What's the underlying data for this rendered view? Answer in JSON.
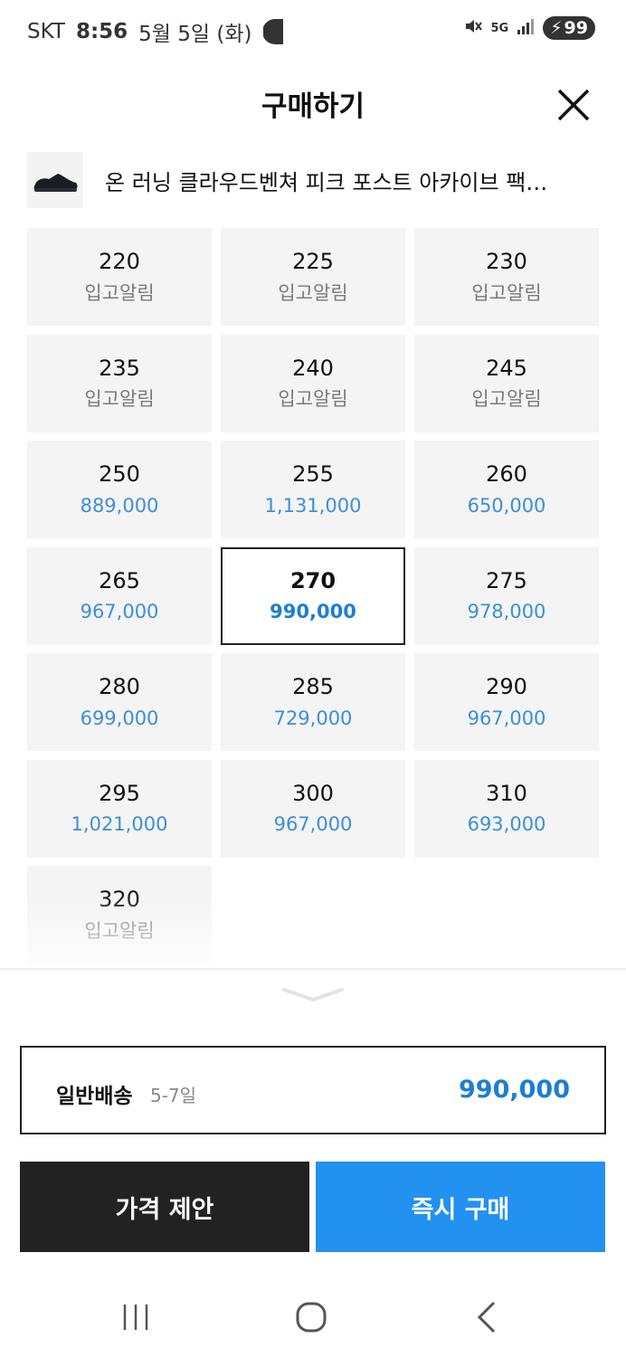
{
  "status_bar": {
    "carrier": "SKT",
    "time": "8:56",
    "date": "5월 5일 (화)",
    "network": "5G",
    "battery": "99"
  },
  "header": {
    "title": "구매하기",
    "close_icon": "close-icon"
  },
  "product": {
    "name": "온 러닝 클라우드벤쳐 피크 포스트 아카이브 팩…",
    "thumbnail_icon": "shoe-thumbnail"
  },
  "sizes": [
    {
      "size": "220",
      "price": "입고알림",
      "kind": "alert"
    },
    {
      "size": "225",
      "price": "입고알림",
      "kind": "alert"
    },
    {
      "size": "230",
      "price": "입고알림",
      "kind": "alert"
    },
    {
      "size": "235",
      "price": "입고알림",
      "kind": "alert"
    },
    {
      "size": "240",
      "price": "입고알림",
      "kind": "alert"
    },
    {
      "size": "245",
      "price": "입고알림",
      "kind": "alert"
    },
    {
      "size": "250",
      "price": "889,000",
      "kind": "price"
    },
    {
      "size": "255",
      "price": "1,131,000",
      "kind": "price"
    },
    {
      "size": "260",
      "price": "650,000",
      "kind": "price"
    },
    {
      "size": "265",
      "price": "967,000",
      "kind": "price"
    },
    {
      "size": "270",
      "price": "990,000",
      "kind": "price",
      "selected": true
    },
    {
      "size": "275",
      "price": "978,000",
      "kind": "price"
    },
    {
      "size": "280",
      "price": "699,000",
      "kind": "price"
    },
    {
      "size": "285",
      "price": "729,000",
      "kind": "price"
    },
    {
      "size": "290",
      "price": "967,000",
      "kind": "price"
    },
    {
      "size": "295",
      "price": "1,021,000",
      "kind": "price"
    },
    {
      "size": "300",
      "price": "967,000",
      "kind": "price"
    },
    {
      "size": "310",
      "price": "693,000",
      "kind": "price"
    },
    {
      "size": "320",
      "price": "입고알림",
      "kind": "alert"
    }
  ],
  "delivery": {
    "label": "일반배송",
    "days": "5-7일",
    "price": "990,000"
  },
  "buttons": {
    "offer": "가격 제안",
    "buy": "즉시 구매"
  },
  "colors": {
    "price_blue": "#3d8fd6",
    "selected_blue": "#1c7fd1",
    "buy_button": "#2291f0",
    "offer_button": "#222222",
    "cell_bg": "#f4f4f4"
  }
}
